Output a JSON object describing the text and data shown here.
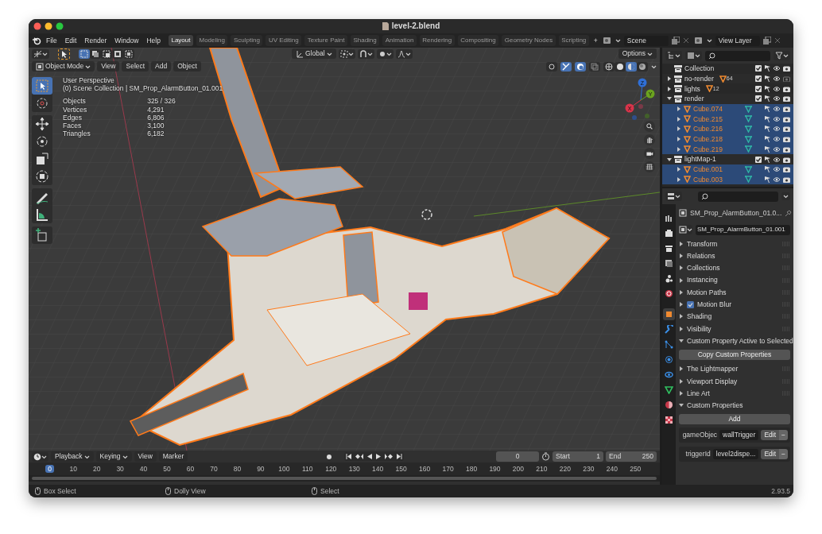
{
  "window": {
    "title": "level-2.blend"
  },
  "menu": [
    "File",
    "Edit",
    "Render",
    "Window",
    "Help"
  ],
  "workspaces": [
    {
      "label": "Layout",
      "selected": true
    },
    {
      "label": "Modeling",
      "selected": false
    },
    {
      "label": "Sculpting",
      "selected": false
    },
    {
      "label": "UV Editing",
      "selected": false
    },
    {
      "label": "Texture Paint",
      "selected": false
    },
    {
      "label": "Shading",
      "selected": false
    },
    {
      "label": "Animation",
      "selected": false
    },
    {
      "label": "Rendering",
      "selected": false
    },
    {
      "label": "Compositing",
      "selected": false
    },
    {
      "label": "Geometry Nodes",
      "selected": false
    },
    {
      "label": "Scripting",
      "selected": false
    }
  ],
  "add_workspace": "+",
  "scene": "Scene",
  "view_layer": "View Layer",
  "viewport": {
    "select_modes": [
      {
        "selected": true
      },
      {
        "selected": false
      },
      {
        "selected": false
      },
      {
        "selected": false
      },
      {
        "selected": false
      }
    ],
    "orientation": "Global",
    "options": "Options",
    "mode": "Object Mode",
    "menus": [
      "View",
      "Select",
      "Add",
      "Object"
    ],
    "shading": [
      {
        "selected": false
      },
      {
        "selected": false
      },
      {
        "selected": true
      },
      {
        "selected": false
      }
    ],
    "info": [
      "User Perspective",
      "(0) Scene Collection | SM_Prop_AlarmButton_01.001"
    ],
    "stats": [
      {
        "label": "Objects",
        "value": "325 / 326"
      },
      {
        "label": "Vertices",
        "value": "4,291"
      },
      {
        "label": "Edges",
        "value": "6,806"
      },
      {
        "label": "Faces",
        "value": "3,100"
      },
      {
        "label": "Triangles",
        "value": "6,182"
      }
    ],
    "tools": [
      {
        "kind": "select",
        "selected": true
      },
      {
        "kind": "cursor",
        "selected": false
      },
      {
        "kind": "move",
        "selected": false
      },
      {
        "kind": "rotate",
        "selected": false
      },
      {
        "kind": "scale",
        "selected": false
      },
      {
        "kind": "transform",
        "selected": false
      },
      {
        "kind": "annotate",
        "selected": false
      },
      {
        "kind": "measure",
        "selected": false
      },
      {
        "kind": "add-cube",
        "selected": false
      }
    ],
    "gizmo": [
      {
        "label": "Z",
        "color": "#2f6fd6"
      },
      {
        "label": "Y",
        "color": "#6ba31f"
      },
      {
        "label": "X",
        "color": "#d8344a"
      }
    ]
  },
  "outliner": {
    "items": [
      {
        "kind": "collection",
        "name": "Collection",
        "selected": false,
        "checked": true,
        "renderable": true
      },
      {
        "kind": "collection",
        "name": "no-render",
        "selected": false,
        "expanded": false,
        "checked": true,
        "renderable": false,
        "badge": "64"
      },
      {
        "kind": "collection",
        "name": "lights",
        "selected": false,
        "expanded": false,
        "checked": true,
        "renderable": true,
        "badge": "12"
      },
      {
        "kind": "collection",
        "name": "render",
        "selected": false,
        "expanded": true,
        "checked": true,
        "renderable": true,
        "children": [
          {
            "kind": "object",
            "name": "Cube.074",
            "selected": true,
            "expanded": false,
            "renderable": true
          },
          {
            "kind": "object",
            "name": "Cube.215",
            "selected": true,
            "expanded": false,
            "renderable": true
          },
          {
            "kind": "object",
            "name": "Cube.216",
            "selected": true,
            "expanded": false,
            "renderable": true
          },
          {
            "kind": "object",
            "name": "Cube.218",
            "selected": true,
            "expanded": false,
            "renderable": true
          },
          {
            "kind": "object",
            "name": "Cube.219",
            "selected": true,
            "expanded": false,
            "renderable": true
          }
        ]
      },
      {
        "kind": "collection",
        "name": "lightMap-1",
        "selected": false,
        "expanded": true,
        "checked": true,
        "renderable": true,
        "children": [
          {
            "kind": "object",
            "name": "Cube.001",
            "selected": true,
            "expanded": false,
            "renderable": true
          },
          {
            "kind": "object",
            "name": "Cube.003",
            "selected": true,
            "expanded": false,
            "renderable": true
          }
        ]
      }
    ]
  },
  "properties": {
    "tabs": [
      {
        "kind": "tool",
        "selected": false
      },
      {
        "kind": "render",
        "selected": false
      },
      {
        "kind": "output",
        "selected": false
      },
      {
        "kind": "view-layer",
        "selected": false
      },
      {
        "kind": "scene",
        "selected": false
      },
      {
        "kind": "world",
        "selected": false
      },
      {
        "kind": "object",
        "selected": true
      },
      {
        "kind": "modifiers",
        "selected": false
      },
      {
        "kind": "particles",
        "selected": false
      },
      {
        "kind": "physics",
        "selected": false
      },
      {
        "kind": "constraints",
        "selected": false
      },
      {
        "kind": "data",
        "selected": false
      },
      {
        "kind": "material",
        "selected": false
      },
      {
        "kind": "texture",
        "selected": false
      }
    ],
    "object_title": "SM_Prop_AlarmButton_01.0...",
    "object_name": "SM_Prop_AlarmButton_01.001",
    "panels": [
      {
        "label": "Transform",
        "expanded": false
      },
      {
        "label": "Relations",
        "expanded": false
      },
      {
        "label": "Collections",
        "expanded": false
      },
      {
        "label": "Instancing",
        "expanded": false
      },
      {
        "label": "Motion Paths",
        "expanded": false
      },
      {
        "label": "Motion Blur",
        "expanded": false,
        "checked": true
      },
      {
        "label": "Shading",
        "expanded": false
      },
      {
        "label": "Visibility",
        "expanded": false
      },
      {
        "label": "Custom Property Active to Selected",
        "expanded": true,
        "button": "Copy Custom Properties"
      },
      {
        "label": "The Lightmapper",
        "expanded": false
      },
      {
        "label": "Viewport Display",
        "expanded": false
      },
      {
        "label": "Line Art",
        "expanded": false
      },
      {
        "label": "Custom Properties",
        "expanded": true,
        "button": "Add",
        "props": [
          {
            "name": "gameObjec",
            "value": "wallTrigger",
            "edit": "Edit",
            "remove": "−"
          },
          {
            "name": "triggerId",
            "value": "level2dispe...",
            "edit": "Edit",
            "remove": "−"
          }
        ]
      }
    ]
  },
  "timeline": {
    "menus": [
      "Playback",
      "Keying",
      "View",
      "Marker"
    ],
    "frame": "0",
    "start_label": "Start",
    "start": "1",
    "end_label": "End",
    "end": "250",
    "playhead": "0",
    "ticks": [
      "10",
      "20",
      "30",
      "40",
      "50",
      "60",
      "70",
      "80",
      "90",
      "100",
      "110",
      "120",
      "130",
      "140",
      "150",
      "160",
      "170",
      "180",
      "190",
      "200",
      "210",
      "220",
      "230",
      "240",
      "250"
    ]
  },
  "status": {
    "hints": [
      "Box Select",
      "Dolly View",
      "Select"
    ],
    "version": "2.93.5"
  }
}
